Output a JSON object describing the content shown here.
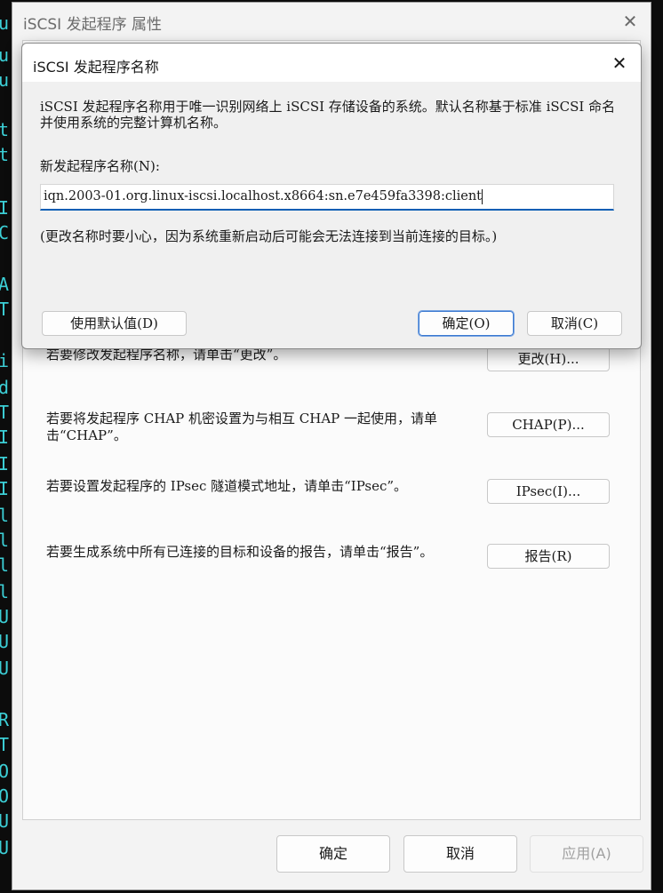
{
  "background": {
    "terminal_glyphs": [
      "u",
      "u",
      "u",
      "t",
      "t",
      "I",
      "C",
      "A",
      "T",
      "i",
      "d",
      "T",
      "I",
      "I",
      "I",
      "l",
      "l",
      "l",
      "l",
      "U",
      "U",
      "U",
      "R",
      "T",
      "O",
      "O",
      "U",
      "U"
    ],
    "accent": "#3ccfd6"
  },
  "parent": {
    "title": "iSCSI 发起程序 属性",
    "rows": [
      {
        "text": "若要修改发起程序名称，请单击“更改”。",
        "button": "更改(H)..."
      },
      {
        "text": "若要将发起程序 CHAP 机密设置为与相互 CHAP 一起使用，请单击“CHAP”。",
        "button": "CHAP(P)..."
      },
      {
        "text": "若要设置发起程序的 IPsec 隧道模式地址，请单击“IPsec”。",
        "button": "IPsec(I)..."
      },
      {
        "text": "若要生成系统中所有已连接的目标和设备的报告，请单击“报告”。",
        "button": "报告(R)"
      }
    ],
    "footer": {
      "ok": "确定",
      "cancel": "取消",
      "apply": "应用(A)"
    }
  },
  "dialog": {
    "title": "iSCSI 发起程序名称",
    "description": "iSCSI 发起程序名称用于唯一识别网络上 iSCSI 存储设备的系统。默认名称基于标准 iSCSI 命名并使用系统的完整计算机名称。",
    "field_label": "新发起程序名称(N):",
    "field_value": "iqn.2003-01.org.linux-iscsi.localhost.x8664:sn.e7e459fa3398:client",
    "warning": "(更改名称时要小心，因为系统重新启动后可能会无法连接到当前连接的目标。)",
    "buttons": {
      "default": "使用默认值(D)",
      "ok": "确定(O)",
      "cancel": "取消(C)"
    }
  }
}
